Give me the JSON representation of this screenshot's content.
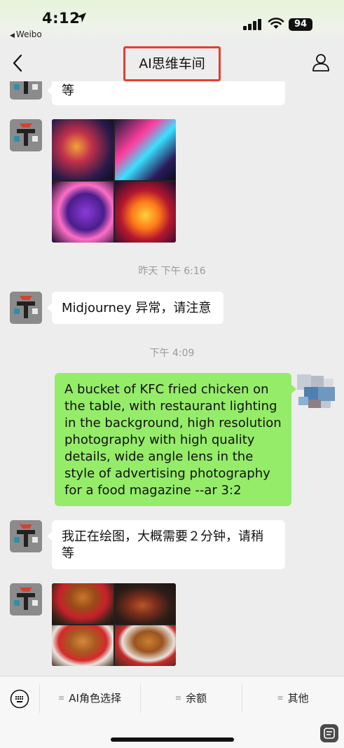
{
  "status_bar": {
    "time": "4:12",
    "back_app": "Weibo",
    "battery": "94"
  },
  "nav": {
    "title": "AI思维车间"
  },
  "messages": {
    "m1_text": "等",
    "timestamp1": "昨天 下午 6:16",
    "m3_text": "Midjourney 异常，请注意",
    "timestamp2": "下午 4:09",
    "m4_text": "A bucket of KFC fried chicken on the table, with restaurant lighting in the background, high resolution photography with high quality details, wide angle lens in the style of advertising photography for a food magazine --ar 3:2",
    "m5_text": "我正在绘图，大概需要２分钟，请稍等"
  },
  "bottom_menu": {
    "item1": "AI角色选择",
    "item2": "余额",
    "item3": "其他"
  },
  "colors": {
    "accent_highlight": "#e2402f",
    "sent_bubble": "#95ec69",
    "received_bubble": "#ffffff",
    "background": "#ededed"
  },
  "icons": [
    "location-arrow-icon",
    "signal-icon",
    "wifi-icon",
    "battery-icon",
    "back-chevron-icon",
    "profile-icon",
    "keyboard-icon",
    "menu-dash-icon",
    "side-tool-icon"
  ]
}
